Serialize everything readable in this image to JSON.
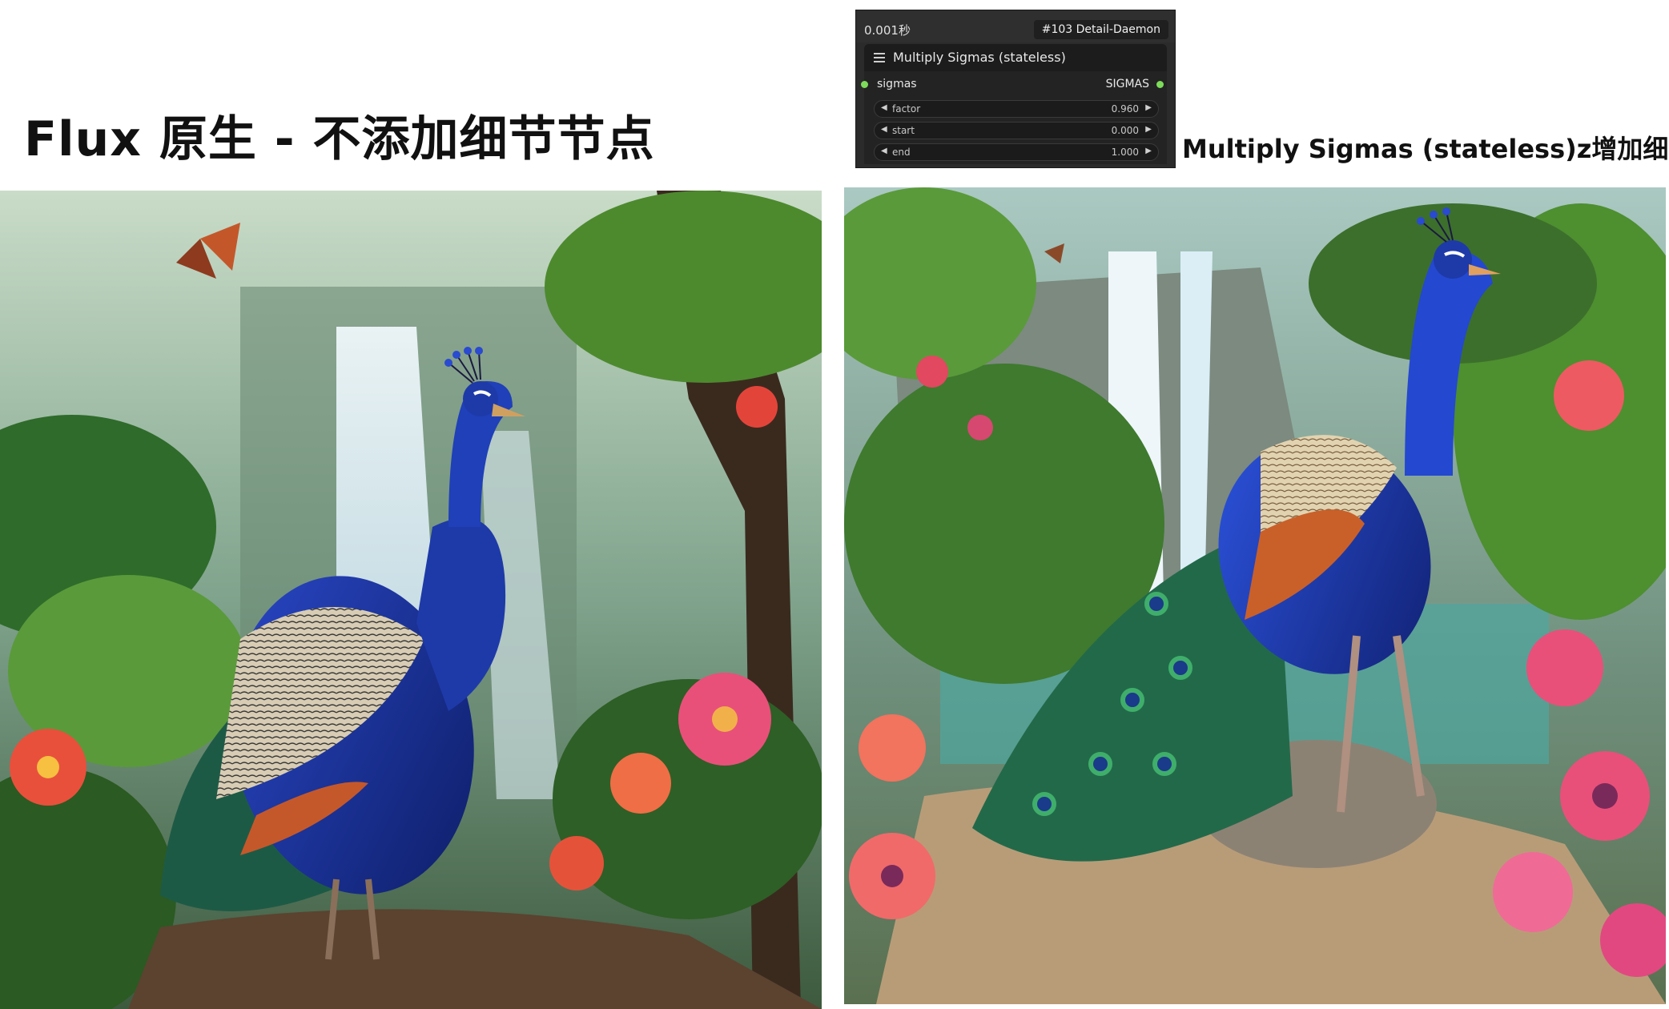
{
  "left_title": "Flux 原生 - 不添加细节节点",
  "right_caption": "Multiply Sigmas (stateless)z增加细节",
  "node": {
    "time": "0.001秒",
    "id_badge": "#103 Detail-Daemon",
    "title": "Multiply Sigmas (stateless)",
    "input_label": "sigmas",
    "output_label": "SIGMAS",
    "widgets": [
      {
        "label": "factor",
        "value": "0.960"
      },
      {
        "label": "start",
        "value": "0.000"
      },
      {
        "label": "end",
        "value": "1.000"
      }
    ]
  },
  "colors": {
    "node_bg": "#2b2b2b",
    "slot_green": "#7ddc5a",
    "peacock_blue": "#1e3aa8",
    "foliage_green": "#3f7a2e",
    "flower_pink": "#e8507a"
  }
}
